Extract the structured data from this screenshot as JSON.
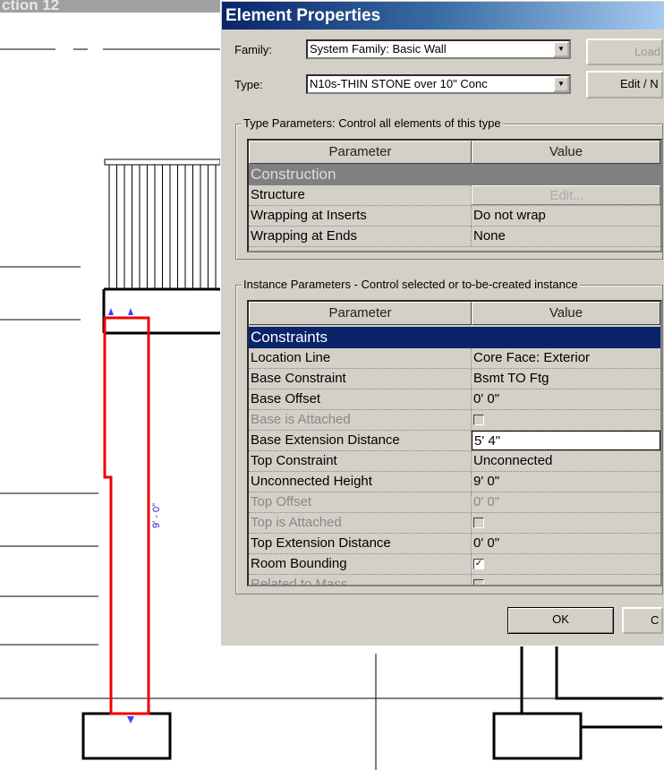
{
  "view_title": "ction 12",
  "dimension_label": "9' - 0\"",
  "dialog": {
    "title": "Element Properties",
    "family_label": "Family:",
    "family_value": "System Family: Basic Wall",
    "type_label": "Type:",
    "type_value": "N10s-THIN STONE over 10\" Conc",
    "load_button": "Load",
    "edit_new_button": "Edit / N",
    "type_params": {
      "legend": "Type Parameters: Control all elements of this type",
      "col_param": "Parameter",
      "col_value": "Value",
      "category": "Construction",
      "rows": [
        {
          "name": "Structure",
          "value": "Edit..."
        },
        {
          "name": "Wrapping at Inserts",
          "value": "Do not wrap"
        },
        {
          "name": "Wrapping at Ends",
          "value": "None"
        }
      ]
    },
    "instance_params": {
      "legend": "Instance Parameters - Control selected or to-be-created instance",
      "col_param": "Parameter",
      "col_value": "Value",
      "category": "Constraints",
      "rows": [
        {
          "name": "Location Line",
          "value": "Core Face: Exterior"
        },
        {
          "name": "Base Constraint",
          "value": "Bsmt TO Ftg"
        },
        {
          "name": "Base Offset",
          "value": "0'  0\""
        },
        {
          "name": "Base is Attached",
          "checked": false,
          "disabled": true
        },
        {
          "name": "Base Extension Distance",
          "value": "5'  4\""
        },
        {
          "name": "Top Constraint",
          "value": "Unconnected"
        },
        {
          "name": "Unconnected Height",
          "value": "9'  0\""
        },
        {
          "name": "Top Offset",
          "value": "0'  0\"",
          "disabled": true
        },
        {
          "name": "Top is Attached",
          "checked": false,
          "disabled": true
        },
        {
          "name": "Top Extension Distance",
          "value": "0'  0\""
        },
        {
          "name": "Room Bounding",
          "checked": true
        },
        {
          "name": "Related to Mass",
          "checked": false,
          "disabled": true
        }
      ]
    },
    "ok_button": "OK",
    "cancel_button": "C"
  }
}
